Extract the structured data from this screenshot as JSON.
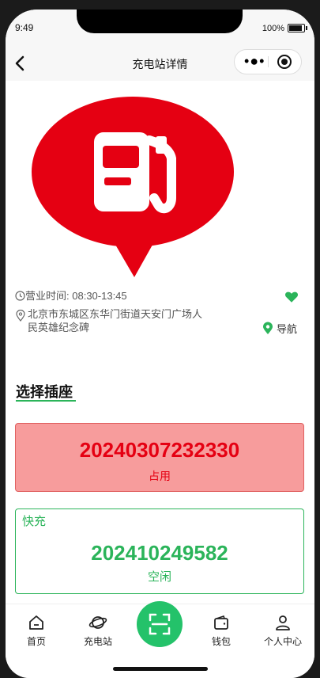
{
  "statusbar": {
    "time": "9:49",
    "battery": "100%"
  },
  "navbar": {
    "title": "充电站详情",
    "back_icon": "back-arrow-icon"
  },
  "station": {
    "hours_label": "营业时间:",
    "hours_value": "08:30-13:45",
    "address_line1": "北京市东城区东华门街道天安门广场人",
    "address_line2": "民英雄纪念碑",
    "navigate_label": "导航"
  },
  "section": {
    "title": "选择插座"
  },
  "sockets": [
    {
      "id": "20240307232330",
      "status": "占用",
      "color": "#e50012"
    },
    {
      "type": "快充",
      "id": "202410249582",
      "status": "空闲",
      "color": "#2bb45a"
    }
  ],
  "tabs": [
    {
      "label": "首页",
      "icon": "home-icon"
    },
    {
      "label": "充电站",
      "icon": "planet-icon"
    },
    {
      "label": "",
      "icon": "scan-icon"
    },
    {
      "label": "钱包",
      "icon": "wallet-icon"
    },
    {
      "label": "个人中心",
      "icon": "user-icon"
    }
  ],
  "colors": {
    "accent": "#2bb45a",
    "brand_red": "#e50012",
    "busy_bg": "#f79c9c"
  }
}
